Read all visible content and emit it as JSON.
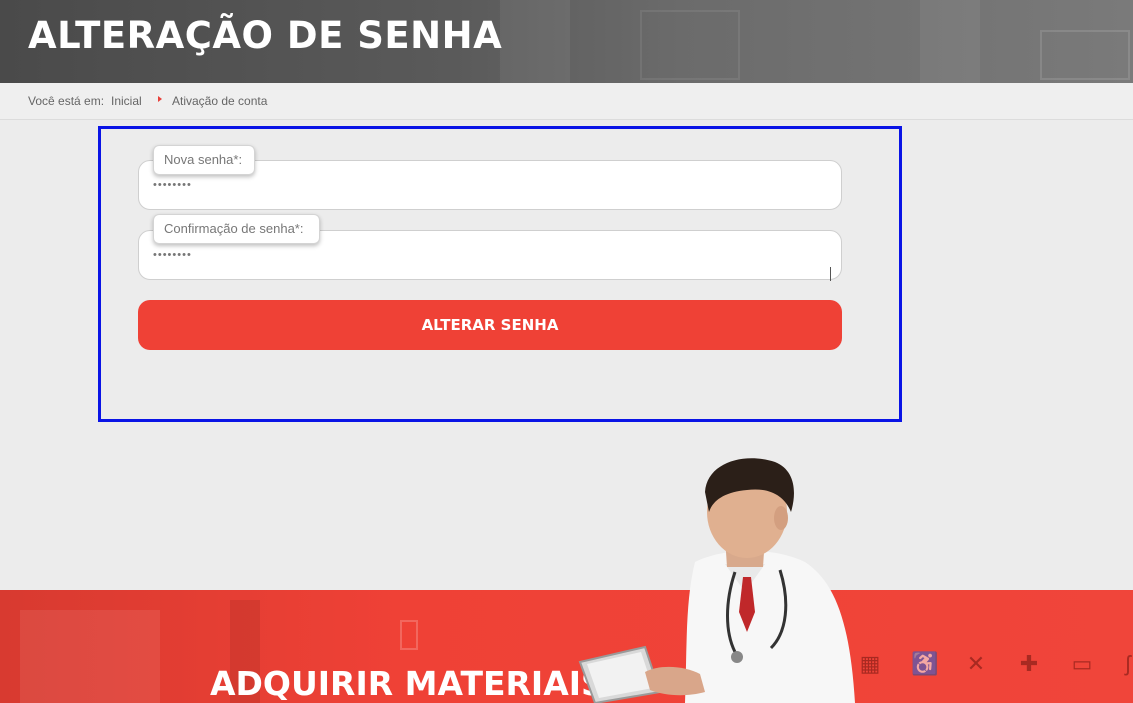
{
  "header": {
    "title": "ALTERAÇÃO DE SENHA"
  },
  "breadcrumb": {
    "prefix": "Você está em:",
    "home": "Inicial",
    "current": "Ativação de conta"
  },
  "form": {
    "new_password": {
      "label": "Nova senha*:",
      "value": "••••••••"
    },
    "confirm_password": {
      "label": "Confirmação de senha*:",
      "value": "••••••••"
    },
    "submit_label": "ALTERAR SENHA"
  },
  "banner": {
    "title": "ADQUIRIR MATERIAIS"
  },
  "colors": {
    "accent": "#ef4136",
    "highlight": "#0a14e6",
    "header_bg": "#555555"
  },
  "icons": [
    "medical-chart-icon",
    "wheelchair-icon",
    "crossed-tools-icon",
    "bandage-icon",
    "monitor-icon",
    "cane-icon"
  ]
}
